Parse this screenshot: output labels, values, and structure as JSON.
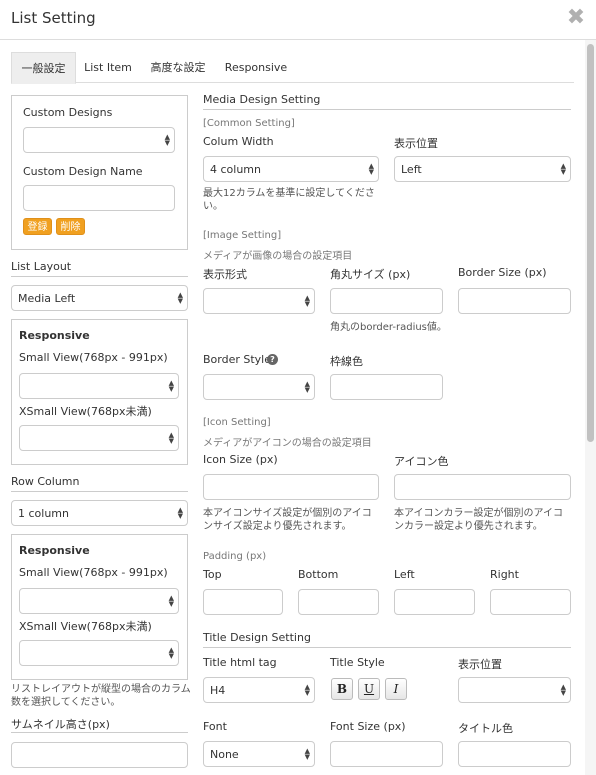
{
  "window": {
    "title": "List Setting"
  },
  "tabs": [
    {
      "label": "一般設定",
      "active": true
    },
    {
      "label": "List Item"
    },
    {
      "label": "高度な設定"
    },
    {
      "label": "Responsive"
    }
  ],
  "left": {
    "custom_designs_label": "Custom Designs",
    "custom_design_name_label": "Custom Design Name",
    "register_button": "登録",
    "delete_button": "削除",
    "list_layout_label": "List Layout",
    "list_layout_value": "Media Left",
    "responsive1": {
      "title": "Responsive",
      "small": "Small View(768px - 991px)",
      "xsmall": "XSmall View(768px未満)"
    },
    "row_column_label": "Row Column",
    "row_column_value": "1 column",
    "responsive2": {
      "title": "Responsive",
      "small": "Small View(768px - 991px)",
      "xsmall": "XSmall View(768px未満)"
    },
    "row_column_help_1": "リストレイアウトが縦型の場合のカラム",
    "row_column_help_2": "数を選択してください。",
    "thumb_height_label": "サムネイル高さ(px)"
  },
  "right": {
    "media_design_heading": "Media Design Setting",
    "common": {
      "heading": "[Common Setting]",
      "col_width_label": "Colum Width",
      "col_width_value": "4 column",
      "col_help_1": "最大12カラムを基準に設定してくださ",
      "col_help_2": "い。",
      "position_label": "表示位置",
      "position_value": "Left"
    },
    "image": {
      "heading": "[Image Setting]",
      "sub": "メディアが画像の場合の設定項目",
      "format_label": "表示形式",
      "radius_label": "角丸サイズ (px)",
      "radius_help": "角丸のborder-radius値。",
      "border_size_label": "Border Size (px)",
      "border_style_label": "Border Style",
      "border_color_label": "枠線色"
    },
    "icon": {
      "heading": "[Icon Setting]",
      "sub": "メディアがアイコンの場合の設定項目",
      "size_label": "Icon Size (px)",
      "size_help_1": "本アイコンサイズ設定が個別のアイコ",
      "size_help_2": "ンサイズ設定より優先されます。",
      "color_label": "アイコン色",
      "color_help_1": "本アイコンカラー設定が個別のアイコ",
      "color_help_2": "ンカラー設定より優先されます。"
    },
    "padding": {
      "heading": "Padding (px)",
      "top": "Top",
      "bottom": "Bottom",
      "left": "Left",
      "right": "Right"
    },
    "title_design": {
      "heading": "Title Design Setting",
      "tag_label": "Title html tag",
      "tag_value": "H4",
      "style_label": "Title Style",
      "bold": "B",
      "underline": "U",
      "italic": "I",
      "position_label": "表示位置",
      "font_label": "Font",
      "font_value": "None",
      "font_size_label": "Font Size (px)",
      "color_label": "タイトル色"
    }
  },
  "icons": {
    "close": "close-icon",
    "help": "question-circle-icon",
    "select_arrow": "updown-arrow-icon"
  }
}
